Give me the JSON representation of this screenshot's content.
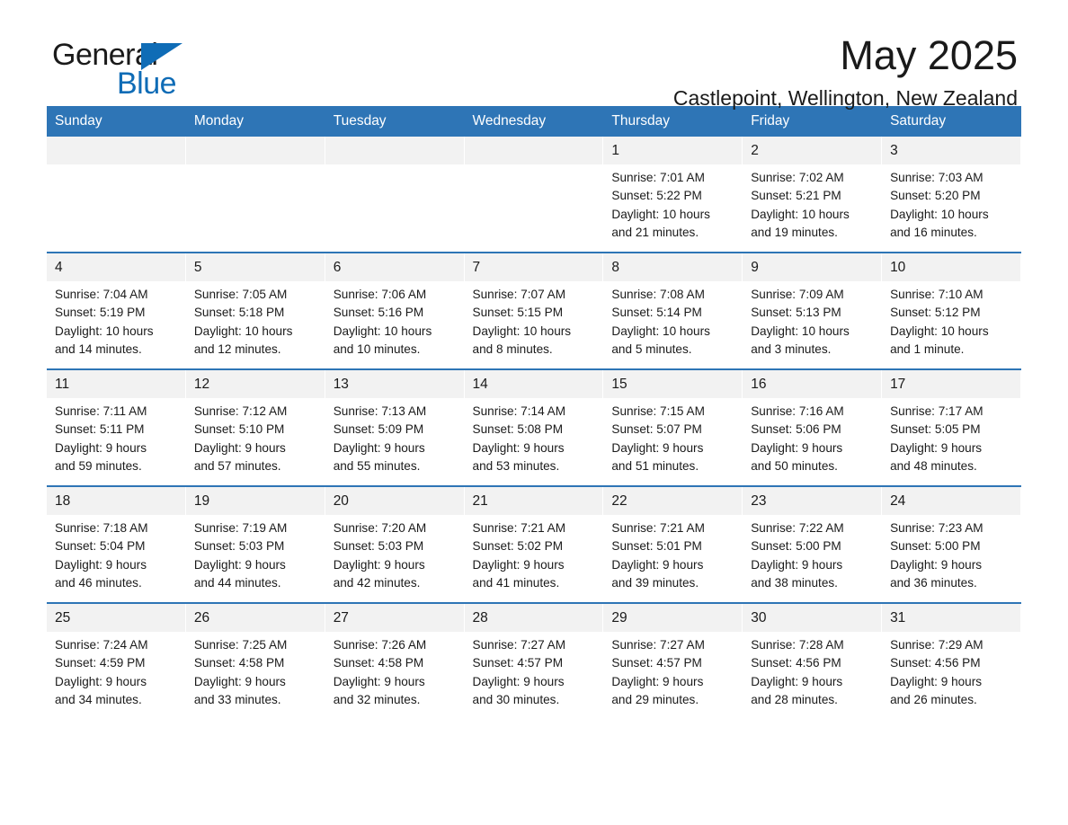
{
  "brand": {
    "name_dark": "General",
    "name_light": "Blue",
    "triangle_color": "#0f6cb6"
  },
  "header": {
    "title": "May 2025",
    "subtitle": "Castlepoint, Wellington, New Zealand"
  },
  "theme": {
    "header_blue": "#2e75b6",
    "date_band": "#f2f2f2",
    "text": "#1a1a1a"
  },
  "weekday_headers": [
    "Sunday",
    "Monday",
    "Tuesday",
    "Wednesday",
    "Thursday",
    "Friday",
    "Saturday"
  ],
  "labels": {
    "sunrise_prefix": "Sunrise:",
    "sunset_prefix": "Sunset:",
    "daylight_prefix": "Daylight:"
  },
  "weeks": [
    [
      {
        "empty": true
      },
      {
        "empty": true
      },
      {
        "empty": true
      },
      {
        "empty": true
      },
      {
        "day": "1",
        "sunrise": "Sunrise: 7:01 AM",
        "sunset": "Sunset: 5:22 PM",
        "daylight_1": "Daylight: 10 hours",
        "daylight_2": "and 21 minutes."
      },
      {
        "day": "2",
        "sunrise": "Sunrise: 7:02 AM",
        "sunset": "Sunset: 5:21 PM",
        "daylight_1": "Daylight: 10 hours",
        "daylight_2": "and 19 minutes."
      },
      {
        "day": "3",
        "sunrise": "Sunrise: 7:03 AM",
        "sunset": "Sunset: 5:20 PM",
        "daylight_1": "Daylight: 10 hours",
        "daylight_2": "and 16 minutes."
      }
    ],
    [
      {
        "day": "4",
        "sunrise": "Sunrise: 7:04 AM",
        "sunset": "Sunset: 5:19 PM",
        "daylight_1": "Daylight: 10 hours",
        "daylight_2": "and 14 minutes."
      },
      {
        "day": "5",
        "sunrise": "Sunrise: 7:05 AM",
        "sunset": "Sunset: 5:18 PM",
        "daylight_1": "Daylight: 10 hours",
        "daylight_2": "and 12 minutes."
      },
      {
        "day": "6",
        "sunrise": "Sunrise: 7:06 AM",
        "sunset": "Sunset: 5:16 PM",
        "daylight_1": "Daylight: 10 hours",
        "daylight_2": "and 10 minutes."
      },
      {
        "day": "7",
        "sunrise": "Sunrise: 7:07 AM",
        "sunset": "Sunset: 5:15 PM",
        "daylight_1": "Daylight: 10 hours",
        "daylight_2": "and 8 minutes."
      },
      {
        "day": "8",
        "sunrise": "Sunrise: 7:08 AM",
        "sunset": "Sunset: 5:14 PM",
        "daylight_1": "Daylight: 10 hours",
        "daylight_2": "and 5 minutes."
      },
      {
        "day": "9",
        "sunrise": "Sunrise: 7:09 AM",
        "sunset": "Sunset: 5:13 PM",
        "daylight_1": "Daylight: 10 hours",
        "daylight_2": "and 3 minutes."
      },
      {
        "day": "10",
        "sunrise": "Sunrise: 7:10 AM",
        "sunset": "Sunset: 5:12 PM",
        "daylight_1": "Daylight: 10 hours",
        "daylight_2": "and 1 minute."
      }
    ],
    [
      {
        "day": "11",
        "sunrise": "Sunrise: 7:11 AM",
        "sunset": "Sunset: 5:11 PM",
        "daylight_1": "Daylight: 9 hours",
        "daylight_2": "and 59 minutes."
      },
      {
        "day": "12",
        "sunrise": "Sunrise: 7:12 AM",
        "sunset": "Sunset: 5:10 PM",
        "daylight_1": "Daylight: 9 hours",
        "daylight_2": "and 57 minutes."
      },
      {
        "day": "13",
        "sunrise": "Sunrise: 7:13 AM",
        "sunset": "Sunset: 5:09 PM",
        "daylight_1": "Daylight: 9 hours",
        "daylight_2": "and 55 minutes."
      },
      {
        "day": "14",
        "sunrise": "Sunrise: 7:14 AM",
        "sunset": "Sunset: 5:08 PM",
        "daylight_1": "Daylight: 9 hours",
        "daylight_2": "and 53 minutes."
      },
      {
        "day": "15",
        "sunrise": "Sunrise: 7:15 AM",
        "sunset": "Sunset: 5:07 PM",
        "daylight_1": "Daylight: 9 hours",
        "daylight_2": "and 51 minutes."
      },
      {
        "day": "16",
        "sunrise": "Sunrise: 7:16 AM",
        "sunset": "Sunset: 5:06 PM",
        "daylight_1": "Daylight: 9 hours",
        "daylight_2": "and 50 minutes."
      },
      {
        "day": "17",
        "sunrise": "Sunrise: 7:17 AM",
        "sunset": "Sunset: 5:05 PM",
        "daylight_1": "Daylight: 9 hours",
        "daylight_2": "and 48 minutes."
      }
    ],
    [
      {
        "day": "18",
        "sunrise": "Sunrise: 7:18 AM",
        "sunset": "Sunset: 5:04 PM",
        "daylight_1": "Daylight: 9 hours",
        "daylight_2": "and 46 minutes."
      },
      {
        "day": "19",
        "sunrise": "Sunrise: 7:19 AM",
        "sunset": "Sunset: 5:03 PM",
        "daylight_1": "Daylight: 9 hours",
        "daylight_2": "and 44 minutes."
      },
      {
        "day": "20",
        "sunrise": "Sunrise: 7:20 AM",
        "sunset": "Sunset: 5:03 PM",
        "daylight_1": "Daylight: 9 hours",
        "daylight_2": "and 42 minutes."
      },
      {
        "day": "21",
        "sunrise": "Sunrise: 7:21 AM",
        "sunset": "Sunset: 5:02 PM",
        "daylight_1": "Daylight: 9 hours",
        "daylight_2": "and 41 minutes."
      },
      {
        "day": "22",
        "sunrise": "Sunrise: 7:21 AM",
        "sunset": "Sunset: 5:01 PM",
        "daylight_1": "Daylight: 9 hours",
        "daylight_2": "and 39 minutes."
      },
      {
        "day": "23",
        "sunrise": "Sunrise: 7:22 AM",
        "sunset": "Sunset: 5:00 PM",
        "daylight_1": "Daylight: 9 hours",
        "daylight_2": "and 38 minutes."
      },
      {
        "day": "24",
        "sunrise": "Sunrise: 7:23 AM",
        "sunset": "Sunset: 5:00 PM",
        "daylight_1": "Daylight: 9 hours",
        "daylight_2": "and 36 minutes."
      }
    ],
    [
      {
        "day": "25",
        "sunrise": "Sunrise: 7:24 AM",
        "sunset": "Sunset: 4:59 PM",
        "daylight_1": "Daylight: 9 hours",
        "daylight_2": "and 34 minutes."
      },
      {
        "day": "26",
        "sunrise": "Sunrise: 7:25 AM",
        "sunset": "Sunset: 4:58 PM",
        "daylight_1": "Daylight: 9 hours",
        "daylight_2": "and 33 minutes."
      },
      {
        "day": "27",
        "sunrise": "Sunrise: 7:26 AM",
        "sunset": "Sunset: 4:58 PM",
        "daylight_1": "Daylight: 9 hours",
        "daylight_2": "and 32 minutes."
      },
      {
        "day": "28",
        "sunrise": "Sunrise: 7:27 AM",
        "sunset": "Sunset: 4:57 PM",
        "daylight_1": "Daylight: 9 hours",
        "daylight_2": "and 30 minutes."
      },
      {
        "day": "29",
        "sunrise": "Sunrise: 7:27 AM",
        "sunset": "Sunset: 4:57 PM",
        "daylight_1": "Daylight: 9 hours",
        "daylight_2": "and 29 minutes."
      },
      {
        "day": "30",
        "sunrise": "Sunrise: 7:28 AM",
        "sunset": "Sunset: 4:56 PM",
        "daylight_1": "Daylight: 9 hours",
        "daylight_2": "and 28 minutes."
      },
      {
        "day": "31",
        "sunrise": "Sunrise: 7:29 AM",
        "sunset": "Sunset: 4:56 PM",
        "daylight_1": "Daylight: 9 hours",
        "daylight_2": "and 26 minutes."
      }
    ]
  ]
}
